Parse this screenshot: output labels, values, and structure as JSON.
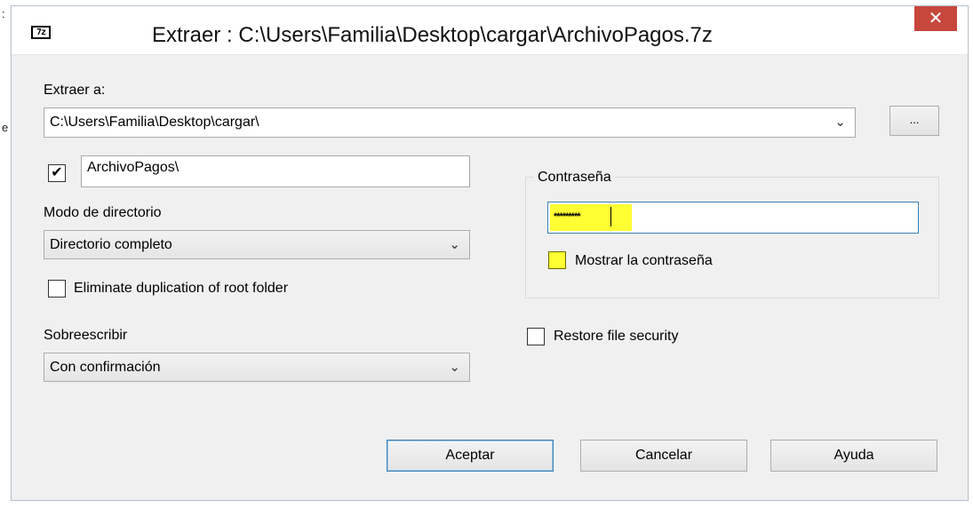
{
  "window": {
    "title": "Extraer : C:\\Users\\Familia\\Desktop\\cargar\\ArchivoPagos.7z",
    "app_icon_text": "7z",
    "close_glyph": "✕"
  },
  "extract_to": {
    "label": "Extraer a:",
    "path": "C:\\Users\\Familia\\Desktop\\cargar\\",
    "browse_label": "..."
  },
  "subfolder": {
    "checked_glyph": "✔",
    "name": "ArchivoPagos\\"
  },
  "directory_mode": {
    "label": "Modo de directorio",
    "selected": "Directorio completo"
  },
  "eliminate_duplication": {
    "label": "Eliminate duplication of root folder"
  },
  "overwrite": {
    "label": "Sobreescribir",
    "selected": "Con confirmación"
  },
  "password": {
    "group_label": "Contraseña",
    "masked_value": "*********",
    "show_label": "Mostrar la contraseña"
  },
  "restore_security": {
    "label": "Restore file security"
  },
  "buttons": {
    "ok": "Aceptar",
    "cancel": "Cancelar",
    "help": "Ayuda"
  },
  "dropdown_glyph": "⌄",
  "colors": {
    "highlight": "#ffff33",
    "close_button": "#c7473d",
    "focus_border": "#3c7fb1"
  }
}
